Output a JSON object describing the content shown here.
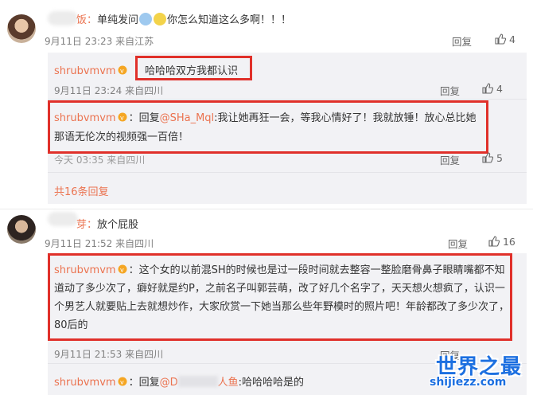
{
  "comments": [
    {
      "user_suffix": "饭：",
      "text": "单纯发问",
      "text2": "你怎么知道这么多啊！！！",
      "time": "9月11日 23:23 来自江苏",
      "reply_label": "回复",
      "likes": "4",
      "sub_replies": [
        {
          "user": "shrubvmvm",
          "text": "哈哈哈双方我都认识",
          "time": "9月11日 23:24 来自四川",
          "reply_label": "回复",
          "likes": "4"
        },
        {
          "user": "shrubvmvm",
          "prefix": "回复",
          "mention": "@SHa_Mql",
          "text": ":我让她再狂一会，等我心情好了！我就放锤！放心总比她那语无伦次的视频强一百倍！",
          "time": "今天 03:35 来自四川",
          "reply_label": "回复",
          "likes": "5"
        }
      ],
      "more": "共16条回复"
    },
    {
      "user_suffix": "芽：",
      "text": "放个屁股",
      "time": "9月11日 21:52 来自四川",
      "reply_label": "回复",
      "likes": "16",
      "sub_replies": [
        {
          "user": "shrubvmvm",
          "text": "：这个女的以前混SH的时候也是过一段时间就去整容一整脸磨骨鼻子眼睛嘴都不知道动了多少次了，癖好就是约P，之前名子叫郭芸萌，改了好几个名字了，天天想火想疯了，认识一个男艺人就要贴上去就想炒作，大家欣赏一下她当那么些年野模时的照片吧！年龄都改了多少次了，80后的",
          "time": "9月11日 21:53 来自四川",
          "reply_label": "回复",
          "likes": ""
        },
        {
          "user": "shrubvmvm",
          "prefix": "：回复",
          "mention": "@D",
          "mention_end": "人鱼",
          "text": ":哈哈哈哈是的"
        }
      ]
    }
  ],
  "watermark": {
    "title": "世界之最",
    "url": "shijiezz.com"
  },
  "colors": {
    "username": "#eb7350",
    "highlight": "#e0302a",
    "subbox": "#f2f2f5",
    "watermark": "#1c6fe0"
  },
  "icons": [
    "thumbs-up-icon",
    "vip-badge-icon",
    "emoji-icon"
  ]
}
